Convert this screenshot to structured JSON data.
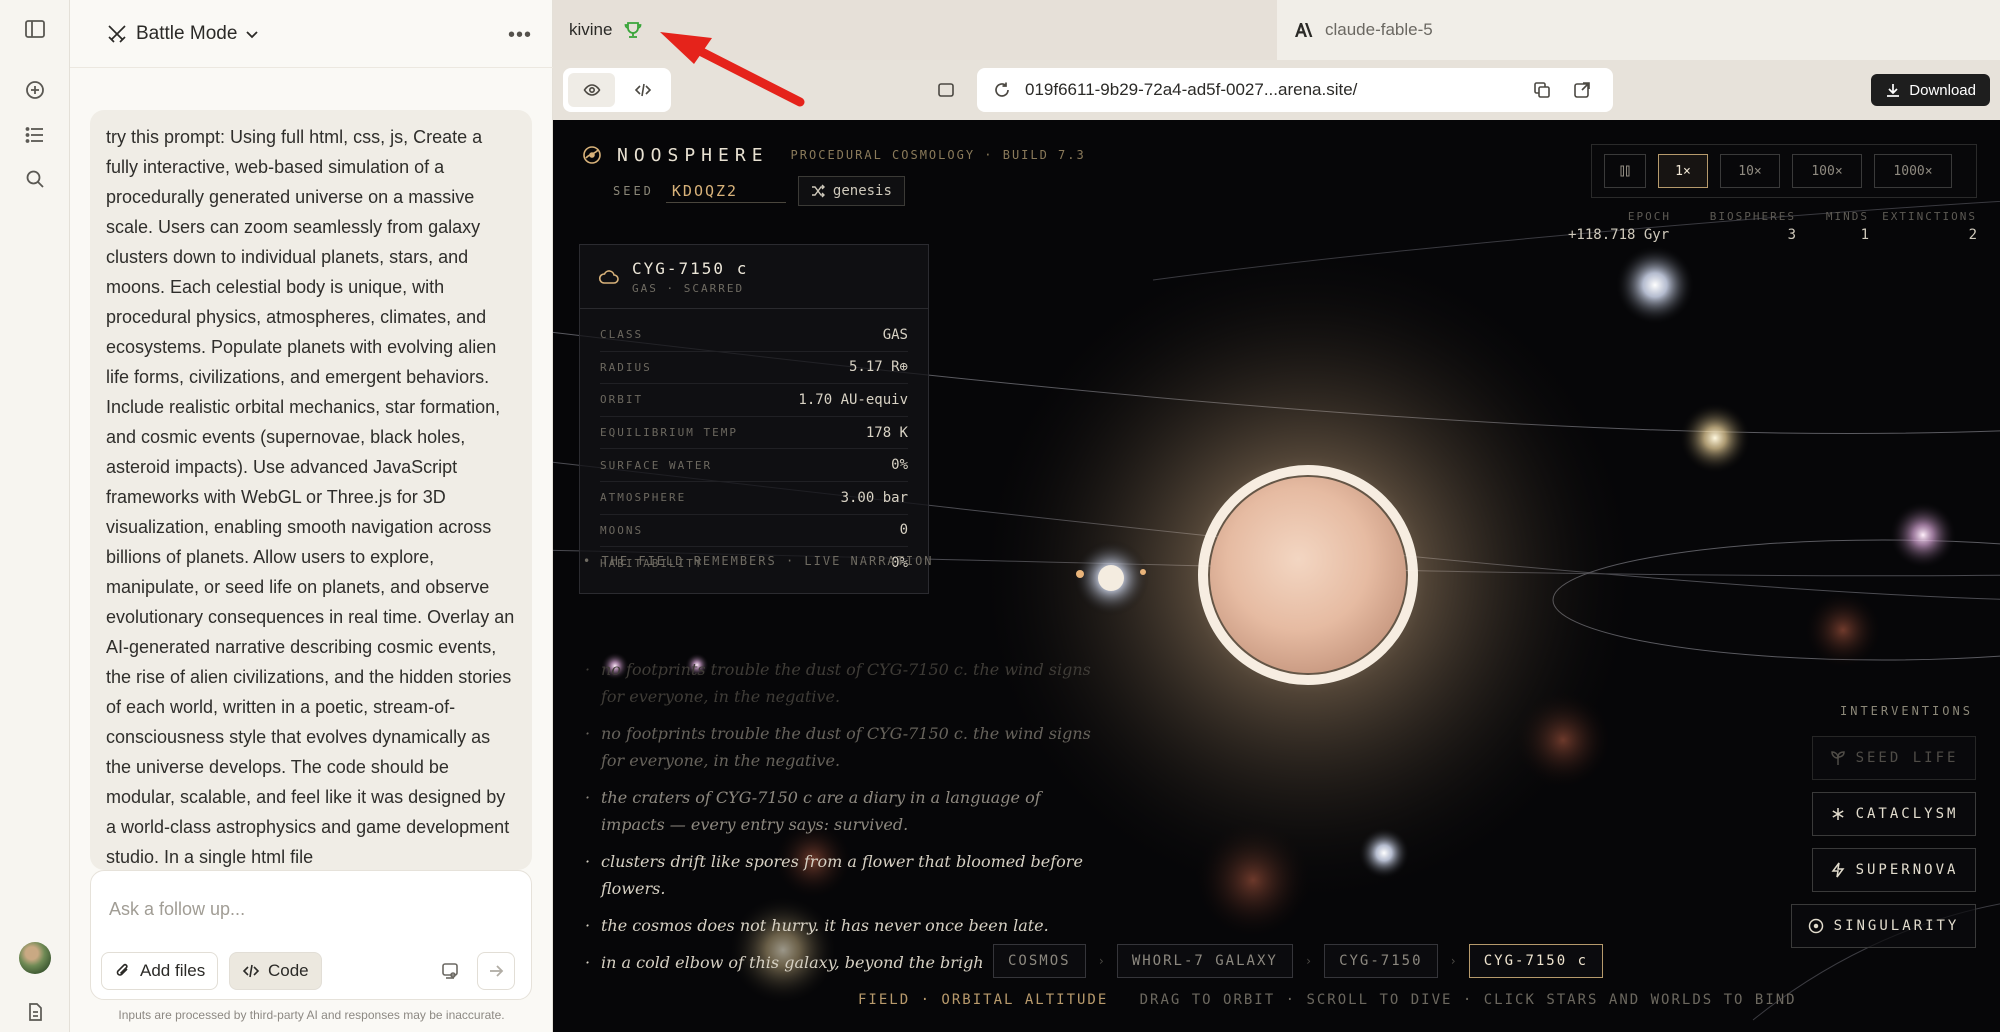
{
  "chat": {
    "mode_label": "Battle Mode",
    "prompt": "try this prompt: Using full html, css, js, Create a fully interactive, web-based simulation of a procedurally generated universe on a massive scale. Users can zoom seamlessly from galaxy clusters down to individual planets, stars, and moons. Each celestial body is unique, with procedural physics, atmospheres, climates, and ecosystems. Populate planets with evolving alien life forms, civilizations, and emergent behaviors. Include realistic orbital mechanics, star formation, and cosmic events (supernovae, black holes, asteroid impacts). Use advanced JavaScript frameworks with WebGL or Three.js for 3D visualization, enabling smooth navigation across billions of planets. Allow users to explore, manipulate, or seed life on planets, and observe evolutionary consequences in real time. Overlay an AI-generated narrative describing cosmic events, the rise of alien civilizations, and the hidden stories of each world, written in a poetic, stream-of-consciousness style that evolves dynamically as the universe develops. The code should be modular, scalable, and feel like it was designed by a world-class astrophysics and game development studio. In a single html file",
    "composer_placeholder": "Ask a follow up...",
    "add_files": "Add files",
    "code": "Code",
    "disclaimer": "Inputs are processed by third-party AI and responses may be inaccurate."
  },
  "tabs": {
    "active": "kivine",
    "inactive": "claude-fable-5"
  },
  "toolbar": {
    "url": "019f6611-9b29-72a4-ad5f-0027...arena.site/",
    "download": "Download"
  },
  "sim": {
    "brand": "NOOSPHERE",
    "subtitle": "PROCEDURAL COSMOLOGY · BUILD 7.3",
    "seed_label": "SEED",
    "seed_value": "KDOQZ2",
    "genesis": "genesis",
    "speeds": [
      "1×",
      "10×",
      "100×",
      "1000×"
    ],
    "active_speed": "1×",
    "stats": {
      "epoch_label": "EPOCH",
      "epoch": "+118.718 Gyr",
      "biospheres_label": "BIOSPHERES",
      "biospheres": "3",
      "minds_label": "MINDS",
      "minds": "1",
      "extinctions_label": "EXTINCTIONS",
      "extinctions": "2"
    },
    "body": {
      "name": "CYG-7150 c",
      "kind": "GAS · SCARRED",
      "rows": [
        {
          "k": "CLASS",
          "v": "GAS"
        },
        {
          "k": "RADIUS",
          "v": "5.17 R⊕"
        },
        {
          "k": "ORBIT",
          "v": "1.70 AU-equiv"
        },
        {
          "k": "EQUILIBRIUM TEMP",
          "v": "178 K"
        },
        {
          "k": "SURFACE WATER",
          "v": "0%"
        },
        {
          "k": "ATMOSPHERE",
          "v": "3.00 bar"
        },
        {
          "k": "MOONS",
          "v": "0"
        },
        {
          "k": "HABITABILITY",
          "v": "0%"
        }
      ]
    },
    "narration_label": "• THE FIELD REMEMBERS · LIVE NARRATION",
    "narration": [
      "no footprints trouble the dust of CYG-7150 c. the wind signs for everyone, in the negative.",
      "no footprints trouble the dust of CYG-7150 c. the wind signs for everyone, in the negative.",
      "the craters of CYG-7150 c are a diary in a language of impacts — every entry says: survived.",
      "clusters drift like spores from a flower that bloomed before flowers.",
      "the cosmos does not hurry. it has never once been late.",
      "in a cold elbow of this galaxy, beyond the brigh"
    ],
    "interventions_label": "INTERVENTIONS",
    "interventions": [
      "SEED LIFE",
      "CATACLYSM",
      "SUPERNOVA",
      "SINGULARITY"
    ],
    "breadcrumbs": [
      "COSMOS",
      "WHORL-7 GALAXY",
      "CYG-7150",
      "CYG-7150 c"
    ],
    "footer_mode": "FIELD · ORBITAL ALTITUDE",
    "footer_hint": "DRAG TO ORBIT · SCROLL TO DIVE · CLICK STARS AND WORLDS TO BIND"
  }
}
